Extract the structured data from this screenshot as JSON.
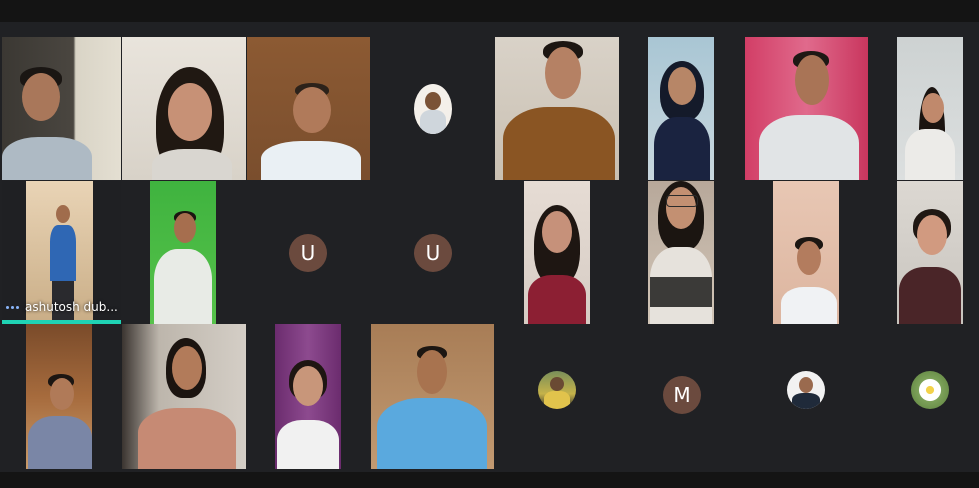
{
  "meeting": {
    "pinned_label": "ashutosh dub...",
    "avatar_letters": [
      "U",
      "U",
      "M"
    ],
    "colors": {
      "background": "#202124",
      "letter_avatar": "#6b4a3e",
      "speaking_indicator": "#1fd3b4",
      "more_options_dots": "#8ab4f8"
    }
  }
}
